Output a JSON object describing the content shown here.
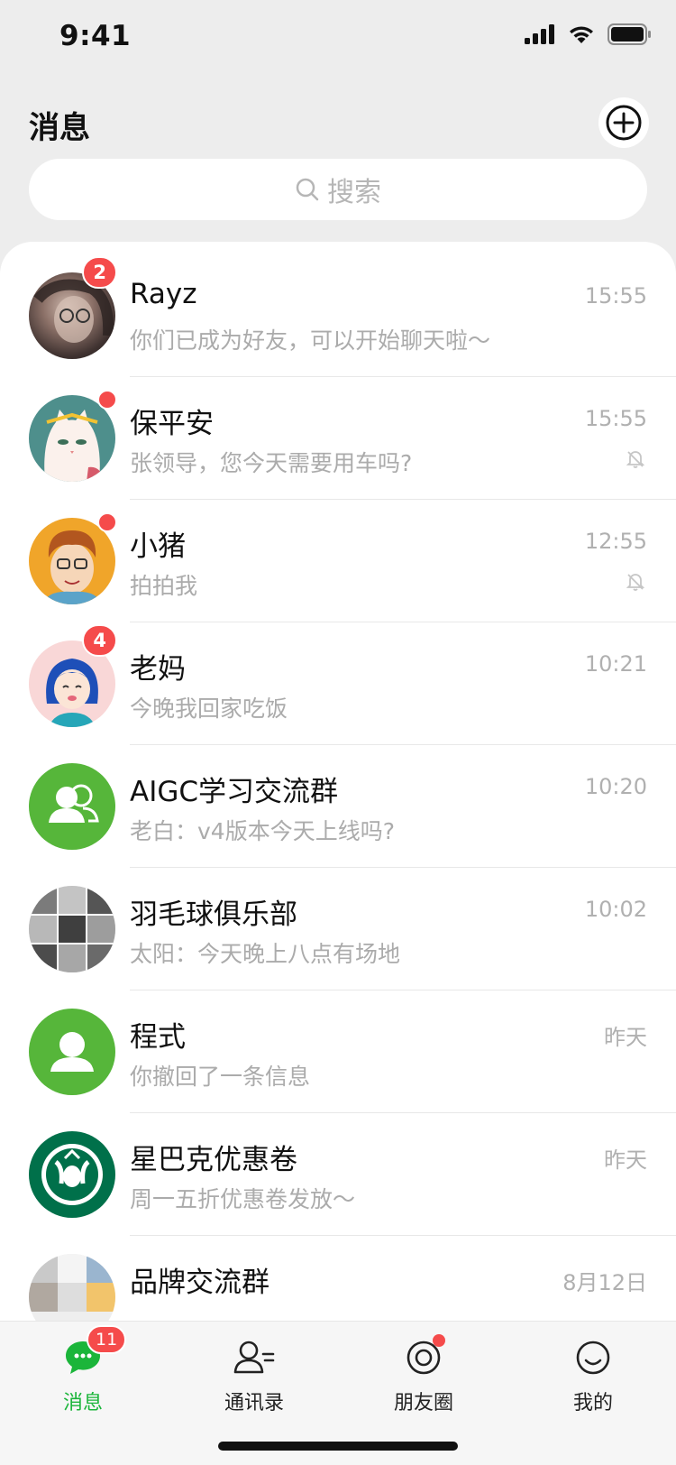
{
  "status": {
    "time": "9:41"
  },
  "header": {
    "title": "消息"
  },
  "search": {
    "placeholder": "搜索"
  },
  "chats": [
    {
      "name": "Rayz",
      "preview": "你们已成为好友，可以开始聊天啦～",
      "time": "15:55",
      "badge": "2",
      "muted": false
    },
    {
      "name": "保平安",
      "preview": "张领导，您今天需要用车吗?",
      "time": "15:55",
      "badge": "",
      "muted": true
    },
    {
      "name": "小猪",
      "preview": "拍拍我",
      "time": "12:55",
      "badge": "",
      "muted": true
    },
    {
      "name": "老妈",
      "preview": "今晚我回家吃饭",
      "time": "10:21",
      "badge": "4",
      "muted": false
    },
    {
      "name": "AIGC学习交流群",
      "preview": "老白：v4版本今天上线吗?",
      "time": "10:20",
      "badge": "",
      "muted": false
    },
    {
      "name": "羽毛球俱乐部",
      "preview": "太阳：今天晚上八点有场地",
      "time": "10:02",
      "badge": "",
      "muted": false
    },
    {
      "name": "程式",
      "preview": "你撤回了一条信息",
      "time": "昨天",
      "badge": "",
      "muted": false
    },
    {
      "name": "星巴克优惠卷",
      "preview": "周一五折优惠卷发放～",
      "time": "昨天",
      "badge": "",
      "muted": false
    },
    {
      "name": "品牌交流群",
      "preview": "",
      "time": "8月12日",
      "badge": "",
      "muted": false
    }
  ],
  "tabbar": {
    "tabs": [
      {
        "label": "消息",
        "badge": "11"
      },
      {
        "label": "通讯录"
      },
      {
        "label": "朋友圈"
      },
      {
        "label": "我的"
      }
    ]
  },
  "colors": {
    "accent": "#1bb53a",
    "badge": "#f54b4b",
    "group_green": "#56b63a"
  }
}
